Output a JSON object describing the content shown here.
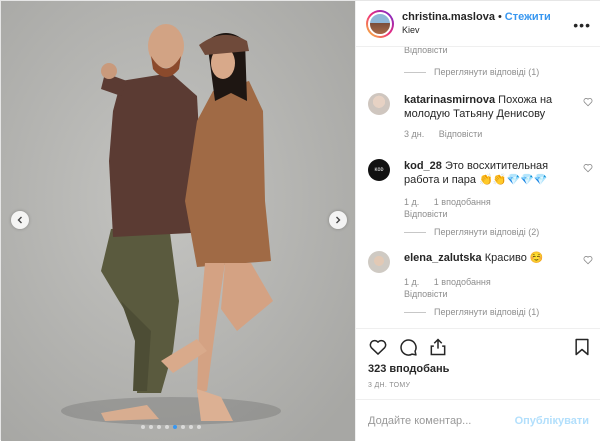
{
  "post": {
    "username": "christina.maslova",
    "separator": "•",
    "follow_label": "Стежити",
    "location": "Kiev",
    "more_icon": "more-horizontal-icon"
  },
  "media": {
    "slide_count": 8,
    "active_slide": 5,
    "prev_icon": "chevron-left-icon",
    "next_icon": "chevron-right-icon"
  },
  "comments": {
    "partial_reply_label": "Відповісти",
    "first_view_replies": "Переглянути відповіді (1)",
    "items": [
      {
        "username": "katarinasmirnova",
        "text": "Похожа на молодую Татьяну Денисову",
        "time": "3 дн.",
        "likes": "",
        "reply_label": "Відповісти",
        "view_replies": ""
      },
      {
        "username": "kod_28",
        "text": "Это восхитительная работа и пара 👏👏💎💎💎",
        "time": "1 д.",
        "likes": "1 вподобання",
        "reply_label": "Відповісти",
        "view_replies": "Переглянути відповіді (2)"
      },
      {
        "username": "elena_zalutska",
        "text": "Красиво ☺️",
        "time": "1 д.",
        "likes": "1 вподобання",
        "reply_label": "Відповісти",
        "view_replies": "Переглянути відповіді (1)"
      }
    ]
  },
  "actions": {
    "like_icon": "heart-icon",
    "comment_icon": "comment-icon",
    "share_icon": "share-icon",
    "save_icon": "bookmark-icon"
  },
  "likes_count": "323 вподобань",
  "posted_ago": "3 дн. тому",
  "add_comment": {
    "placeholder": "Додайте коментар...",
    "publish_label": "Опублікувати"
  },
  "colors": {
    "accent": "#3897f0",
    "publish_disabled": "#b2dffc",
    "muted_text": "#8e8e8e"
  }
}
